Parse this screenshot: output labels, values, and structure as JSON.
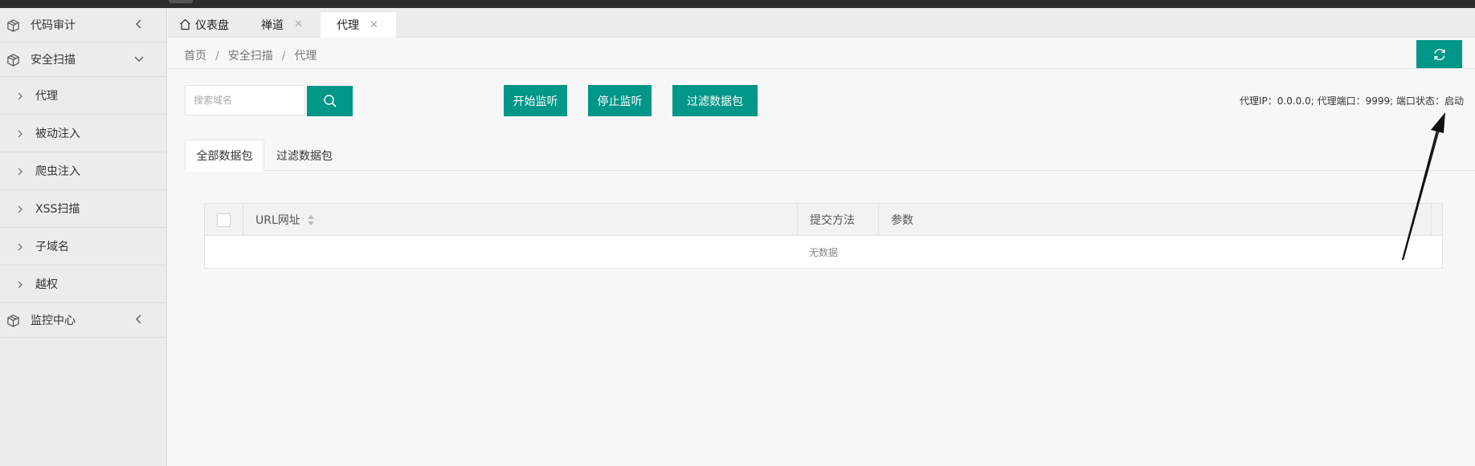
{
  "sidebar": {
    "items": [
      {
        "label": "代码审计",
        "icon": "cube-icon",
        "chevron": "chevron-left-icon"
      },
      {
        "label": "安全扫描",
        "icon": "cube-icon",
        "chevron": "chevron-down-icon",
        "children": [
          "代理",
          "被动注入",
          "爬虫注入",
          "XSS扫描",
          "子域名",
          "越权"
        ]
      },
      {
        "label": "监控中心",
        "icon": "cube-icon",
        "chevron": "chevron-left-icon"
      }
    ]
  },
  "tabs": [
    {
      "label": "仪表盘",
      "icon": "home-icon",
      "closable": false
    },
    {
      "label": "禅道",
      "closable": true
    },
    {
      "label": "代理",
      "closable": true,
      "active": true
    }
  ],
  "tab_close_glyph": "✕",
  "breadcrumb": [
    "首页",
    "安全扫描",
    "代理"
  ],
  "breadcrumb_sep": "/",
  "search": {
    "placeholder": "搜索域名",
    "value": ""
  },
  "toolbar": {
    "start_label": "开始监听",
    "stop_label": "停止监听",
    "filter_label": "过滤数据包"
  },
  "proxy_status": "代理IP：0.0.0.0; 代理端口：9999; 端口状态：启动",
  "subtabs": [
    {
      "label": "全部数据包",
      "active": true
    },
    {
      "label": "过滤数据包",
      "active": false
    }
  ],
  "table": {
    "columns": [
      "URL网址",
      "提交方法",
      "参数"
    ],
    "empty_text": "无数据"
  },
  "colors": {
    "accent": "#009688",
    "sidebar_bg": "#ececec",
    "topbar": "#2b2b2b"
  }
}
